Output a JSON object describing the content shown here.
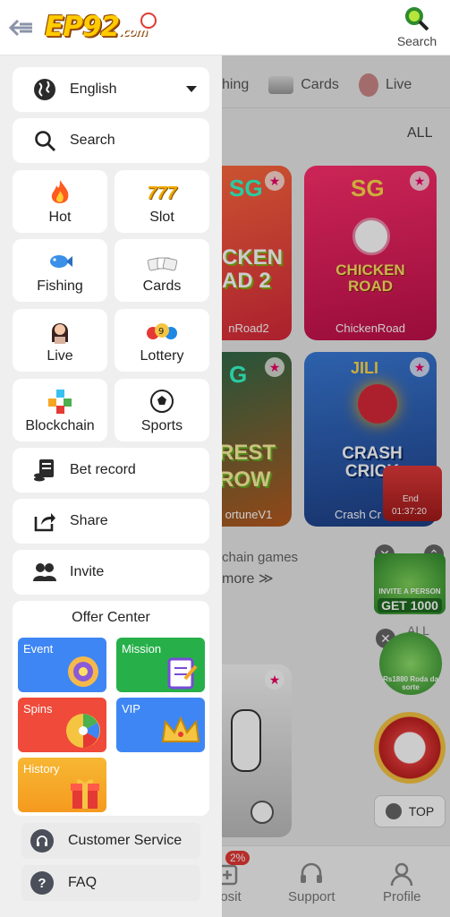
{
  "header": {
    "logo_text": "EP92",
    "logo_suffix": ".com",
    "search_label": "Search"
  },
  "background": {
    "tabs": [
      {
        "label": "hing"
      },
      {
        "label": "Cards"
      },
      {
        "label": "Live"
      }
    ],
    "all_label": "ALL",
    "games": [
      {
        "name": "nRoad2",
        "brand": "SG",
        "art_text": "CKEN AD 2"
      },
      {
        "name": "ChickenRoad",
        "brand": "SG",
        "art_text": "CHICKEN ROAD"
      },
      {
        "name": "ortuneV1",
        "brand": "G",
        "art_text": "REST ROW"
      },
      {
        "name": "Crash Cr",
        "brand": "JILI",
        "art_text": "CRASH CRICK"
      }
    ],
    "chain_text": "chain games",
    "more_text": "more ≫",
    "all_label_2": "ALL",
    "promo_end": "End",
    "promo_timer": "01:37:20",
    "invite_text": "INVITE A PERSON",
    "invite_get": "GET 1000",
    "wheel_text": "Rs1880 Roda da sorte",
    "top_label": "TOP",
    "bottom_nav": {
      "deposit": "posit",
      "support": "Support",
      "profile": "Profile",
      "badge": "2%"
    }
  },
  "drawer": {
    "language": "English",
    "search": "Search",
    "categories": [
      {
        "label": "Hot"
      },
      {
        "label": "Slot"
      },
      {
        "label": "Fishing"
      },
      {
        "label": "Cards"
      },
      {
        "label": "Live"
      },
      {
        "label": "Lottery"
      },
      {
        "label": "Blockchain"
      },
      {
        "label": "Sports"
      }
    ],
    "bet_record": "Bet record",
    "share": "Share",
    "invite": "Invite",
    "offer_title": "Offer Center",
    "offers": [
      {
        "label": "Event",
        "color": "#3f86f5"
      },
      {
        "label": "Mission",
        "color": "#27b04a"
      },
      {
        "label": "Spins",
        "color": "#ef4a3a"
      },
      {
        "label": "VIP",
        "color": "#3f86f5"
      },
      {
        "label": "History",
        "color": "#f5a623"
      }
    ],
    "customer_service": "Customer Service",
    "faq": "FAQ"
  }
}
